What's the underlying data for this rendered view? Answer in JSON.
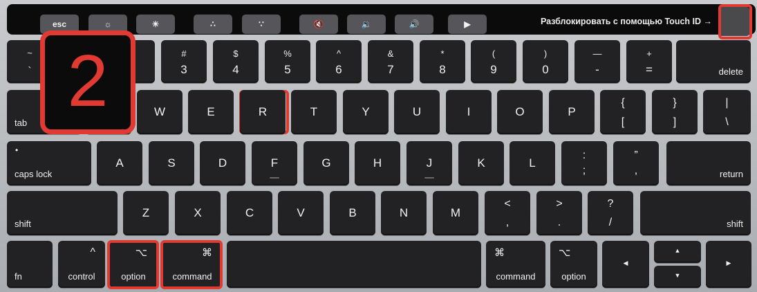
{
  "touchbar": {
    "esc": "esc",
    "buttons": [
      "☼",
      "☀",
      "∴",
      "∵",
      "🔇",
      "🔉",
      "🔊",
      "▶"
    ],
    "unlock_text": "Разблокировать с помощью Touch ID →"
  },
  "row1": {
    "tilde": [
      "~",
      "`"
    ],
    "digits": [
      {
        "up": "#",
        "dn": "3"
      },
      {
        "up": "$",
        "dn": "4"
      },
      {
        "up": "%",
        "dn": "5"
      },
      {
        "up": "^",
        "dn": "6"
      },
      {
        "up": "&",
        "dn": "7"
      },
      {
        "up": "*",
        "dn": "8"
      },
      {
        "up": "(",
        "dn": "9"
      },
      {
        "up": ")",
        "dn": "0"
      },
      {
        "up": "—",
        "dn": "-"
      },
      {
        "up": "+",
        "dn": "="
      }
    ],
    "delete": "delete"
  },
  "row2": {
    "tab": "tab",
    "letters": [
      "W",
      "E",
      "R",
      "T",
      "Y",
      "U",
      "I",
      "O",
      "P"
    ],
    "brackets": [
      {
        "up": "{",
        "dn": "["
      },
      {
        "up": "}",
        "dn": "]"
      },
      {
        "up": "|",
        "dn": "\\"
      }
    ]
  },
  "row3": {
    "capslock": "caps lock",
    "capslock_dot": "•",
    "letters": [
      "A",
      "S",
      "D",
      "F",
      "G",
      "H",
      "J",
      "K",
      "L"
    ],
    "punct": [
      {
        "up": ":",
        "dn": ";"
      },
      {
        "up": "”",
        "dn": ","
      }
    ],
    "return": "return"
  },
  "row4": {
    "shift_left": "shift",
    "letters": [
      "Z",
      "X",
      "C",
      "V",
      "B",
      "N",
      "M"
    ],
    "punct": [
      {
        "up": "<",
        "dn": ","
      },
      {
        "up": ">",
        "dn": "."
      },
      {
        "up": "?",
        "dn": "/"
      }
    ],
    "shift_right": "shift"
  },
  "row5": {
    "fn": "fn",
    "control": {
      "sym": "^",
      "label": "control"
    },
    "option_left": {
      "sym": "⌥",
      "label": "option"
    },
    "command_left": {
      "sym": "⌘",
      "label": "command"
    },
    "command_right": {
      "sym": "⌘",
      "label": "command"
    },
    "option_right": {
      "sym": "⌥",
      "label": "option"
    },
    "arrows": {
      "left": "◀",
      "up": "▲",
      "down": "▼",
      "right": "▶"
    }
  },
  "step_badge": "2",
  "colors": {
    "highlight": "#e03a32",
    "key": "#222224",
    "touchbar": "#0b0b0c"
  }
}
